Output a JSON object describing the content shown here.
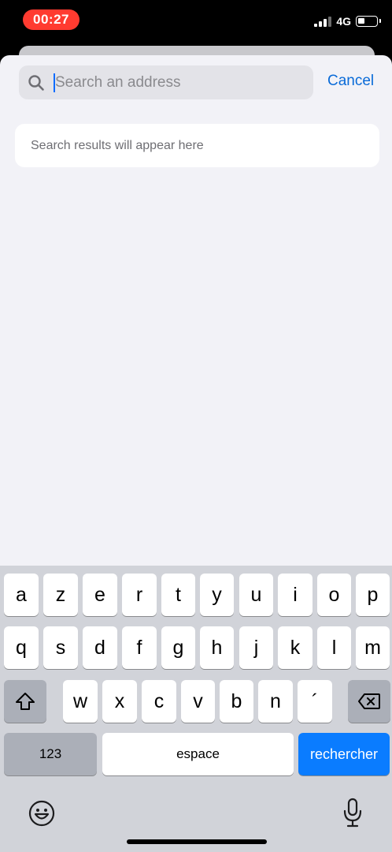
{
  "status_bar": {
    "time": "00:27",
    "network": "4G",
    "colors": {
      "time_pill": "#ff3b30"
    },
    "icons": [
      "signal-icon",
      "battery-icon"
    ]
  },
  "search": {
    "placeholder": "Search an address",
    "value": "",
    "cancel_label": "Cancel"
  },
  "results": {
    "empty_text": "Search results will appear here"
  },
  "keyboard": {
    "row1": [
      "a",
      "z",
      "e",
      "r",
      "t",
      "y",
      "u",
      "i",
      "o",
      "p"
    ],
    "row2": [
      "q",
      "s",
      "d",
      "f",
      "g",
      "h",
      "j",
      "k",
      "l",
      "m"
    ],
    "row3": [
      "w",
      "x",
      "c",
      "v",
      "b",
      "n",
      "´"
    ],
    "numbers_label": "123",
    "space_label": "espace",
    "return_label": "rechercher",
    "icons": [
      "shift-icon",
      "backspace-icon",
      "emoji-icon",
      "microphone-icon"
    ],
    "colors": {
      "return_key": "#0a7cff",
      "accent": "#0a6bd8"
    }
  }
}
